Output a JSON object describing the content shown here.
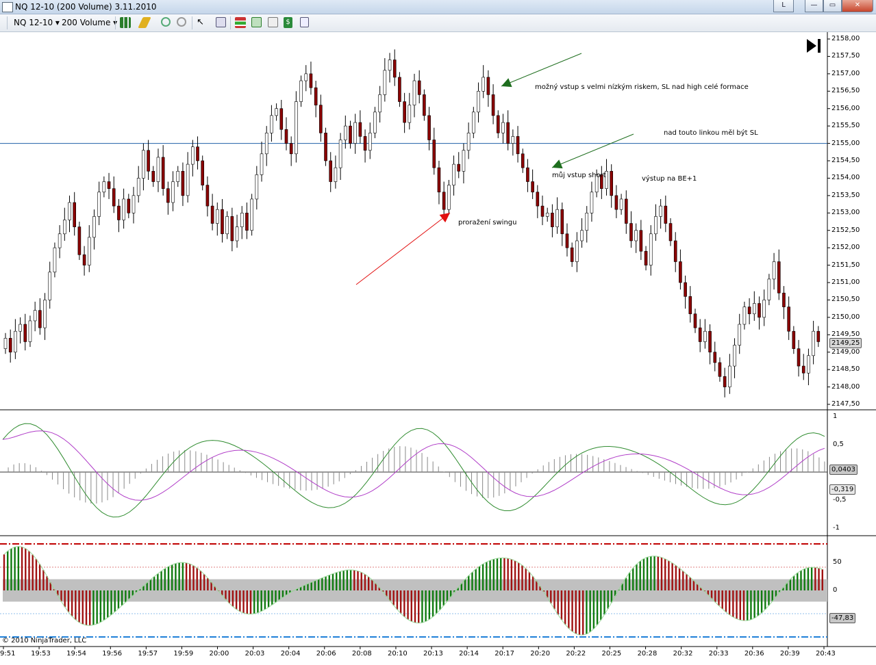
{
  "window": {
    "title": "NQ 12-10 (200 Volume)  3.11.2010",
    "buttons": [
      "L",
      "—",
      "▭",
      "✕"
    ]
  },
  "toolbar": {
    "instrument": "NQ 12-10",
    "interval": "200 Volume",
    "icons": [
      "bar-style-icon",
      "pencil-draw-icon",
      "zoom-in-icon",
      "zoom-out-icon",
      "cursor-icon",
      "magnifier-icon",
      "strategies-icon",
      "indicators-icon",
      "chart-properties-icon",
      "dollar-icon",
      "data-box-icon"
    ]
  },
  "price_panel": {
    "ticks": [
      "2158,00",
      "2157,50",
      "2157,00",
      "2156,50",
      "2156,00",
      "2155,50",
      "2155,00",
      "2154,50",
      "2154,00",
      "2153,50",
      "2153,00",
      "2152,50",
      "2152,00",
      "2151,50",
      "2151,00",
      "2150,50",
      "2150,00",
      "2149,50",
      "2149,00",
      "2148,50",
      "2148,00",
      "2147,50"
    ],
    "current_price": "2149,25",
    "horizontal_line_price": 2155.0,
    "annotations": {
      "entry_low_risk": "možný vstup s velmi nízkým riskem, SL nad high celé formace",
      "sl_line_note": "nad touto linkou měl být SL",
      "my_entry": "můj vstup short",
      "exit": "výstup na BE+1",
      "swing_break": "proražení swingu"
    }
  },
  "macd_panel": {
    "ticks": [
      "1",
      "0,5",
      "-0,5",
      "-1"
    ],
    "tag_green": "0,0403",
    "tag_magenta": "-0,319"
  },
  "osc_panel": {
    "ticks": [
      "50",
      "0"
    ],
    "tag_value": "-47,83"
  },
  "time_axis": [
    "9:51",
    "19:53",
    "19:54",
    "19:56",
    "19:57",
    "19:59",
    "20:00",
    "20:03",
    "20:04",
    "20:06",
    "20:08",
    "20:10",
    "20:13",
    "20:14",
    "20:17",
    "20:20",
    "20:22",
    "20:25",
    "20:28",
    "20:32",
    "20:33",
    "20:36",
    "20:39",
    "20:43"
  ],
  "copyright": "© 2010 NinjaTrader, LLC",
  "colors": {
    "up_candle": "#ffffff",
    "down_candle": "#8b0000",
    "hline": "#1f5fa8",
    "macd": "#2e8b2e",
    "signal": "#b03cc8",
    "osc_up": "#0e7a0e",
    "osc_down": "#a01010",
    "red_dashdot": "#c00000",
    "blue_dashdot": "#1e7fd8"
  },
  "chart_data": {
    "type": "candlestick",
    "price_range": [
      2147.5,
      2158.0
    ],
    "closes": [
      2149.4,
      2149.0,
      2149.6,
      2149.8,
      2149.3,
      2149.9,
      2150.2,
      2149.7,
      2150.5,
      2151.3,
      2152.0,
      2152.4,
      2152.8,
      2153.3,
      2152.6,
      2151.8,
      2151.5,
      2152.3,
      2152.9,
      2153.6,
      2153.9,
      2153.7,
      2153.2,
      2152.8,
      2153.4,
      2153.0,
      2153.5,
      2154.0,
      2154.8,
      2154.2,
      2153.9,
      2154.6,
      2153.7,
      2153.3,
      2153.9,
      2154.2,
      2153.5,
      2154.4,
      2154.9,
      2154.5,
      2153.8,
      2153.2,
      2152.7,
      2153.1,
      2152.4,
      2152.9,
      2152.2,
      2152.6,
      2153.0,
      2152.5,
      2153.4,
      2154.1,
      2154.7,
      2155.3,
      2155.8,
      2156.0,
      2155.4,
      2155.0,
      2154.7,
      2156.2,
      2156.8,
      2157.0,
      2156.6,
      2156.1,
      2155.3,
      2154.5,
      2153.9,
      2154.3,
      2155.1,
      2155.5,
      2155.0,
      2155.6,
      2155.2,
      2154.8,
      2155.3,
      2155.9,
      2156.4,
      2157.1,
      2157.4,
      2156.9,
      2156.2,
      2155.6,
      2156.1,
      2156.8,
      2156.4,
      2155.8,
      2155.1,
      2154.3,
      2153.6,
      2153.1,
      2153.8,
      2154.4,
      2154.2,
      2154.8,
      2155.3,
      2155.9,
      2156.5,
      2156.9,
      2156.4,
      2155.8,
      2155.3,
      2155.6,
      2155.0,
      2155.2,
      2154.7,
      2154.3,
      2153.9,
      2153.6,
      2153.2,
      2152.9,
      2153.0,
      2152.6,
      2153.1,
      2152.4,
      2152.0,
      2151.6,
      2152.2,
      2152.5,
      2153.0,
      2153.6,
      2154.1,
      2153.7,
      2154.2,
      2153.5,
      2153.1,
      2153.4,
      2152.7,
      2152.2,
      2152.5,
      2151.9,
      2151.5,
      2152.4,
      2152.9,
      2153.2,
      2152.7,
      2152.2,
      2151.6,
      2151.0,
      2150.6,
      2150.1,
      2149.7,
      2149.3,
      2149.6,
      2149.0,
      2148.7,
      2148.3,
      2148.0,
      2148.6,
      2149.2,
      2149.8,
      2150.3,
      2150.1,
      2150.4,
      2150.0,
      2150.5,
      2151.1,
      2151.6,
      2150.7,
      2150.3,
      2149.6,
      2149.1,
      2148.6,
      2148.4,
      2148.9,
      2149.6,
      2149.3
    ]
  }
}
